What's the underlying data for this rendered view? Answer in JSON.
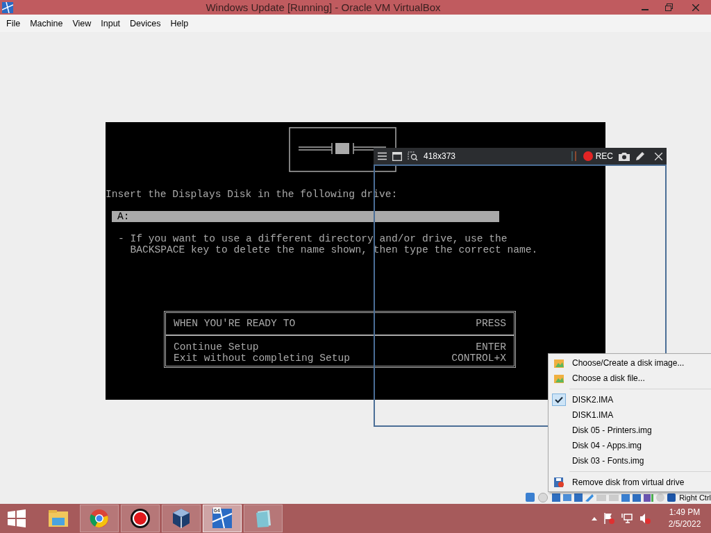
{
  "window": {
    "title": "Windows Update [Running] - Oracle VM VirtualBox"
  },
  "menu_bar": [
    "File",
    "Machine",
    "View",
    "Input",
    "Devices",
    "Help"
  ],
  "guest_screen": {
    "prompt": "Insert the Displays Disk in the following drive:",
    "drive_field": "A:",
    "hint_lines": [
      "- If you want to use a different directory and/or drive, use the",
      "  BACKSPACE key to delete the name shown, then type the correct name."
    ],
    "keys_table": {
      "header": [
        "WHEN YOU'RE READY TO",
        "PRESS"
      ],
      "rows": [
        [
          "Continue Setup",
          "ENTER"
        ],
        [
          "Exit without completing Setup",
          "CONTROL+X"
        ]
      ]
    }
  },
  "recorder_toolbar": {
    "size": "418x373",
    "rec_label": "REC"
  },
  "status_bar": {
    "host_key": "Right Ctrl"
  },
  "popup_menu": {
    "items": [
      {
        "kind": "choose",
        "label": "Choose/Create a disk image..."
      },
      {
        "kind": "choose",
        "label": "Choose a disk file..."
      },
      {
        "kind": "separator"
      },
      {
        "kind": "disk",
        "label": "DISK2.IMA",
        "checked": true
      },
      {
        "kind": "disk",
        "label": "DISK1.IMA",
        "checked": false
      },
      {
        "kind": "disk",
        "label": "Disk 05 - Printers.img",
        "checked": false
      },
      {
        "kind": "disk",
        "label": "Disk 04 - Apps.img",
        "checked": false
      },
      {
        "kind": "disk",
        "label": "Disk 03 - Fonts.img",
        "checked": false
      },
      {
        "kind": "separator"
      },
      {
        "kind": "remove",
        "label": "Remove disk from virtual drive"
      }
    ]
  },
  "taskbar": {
    "apps": [
      {
        "kind": "explorer",
        "running": false,
        "selected": false
      },
      {
        "kind": "chrome",
        "running": true,
        "selected": false
      },
      {
        "kind": "recorder",
        "running": true,
        "selected": false
      },
      {
        "kind": "virtualbox",
        "running": true,
        "selected": false
      },
      {
        "kind": "vm",
        "badge": "64",
        "running": true,
        "selected": true
      },
      {
        "kind": "notepad",
        "running": true,
        "selected": false
      }
    ],
    "clock": {
      "time": "1:49 PM",
      "date": "2/5/2022"
    }
  }
}
